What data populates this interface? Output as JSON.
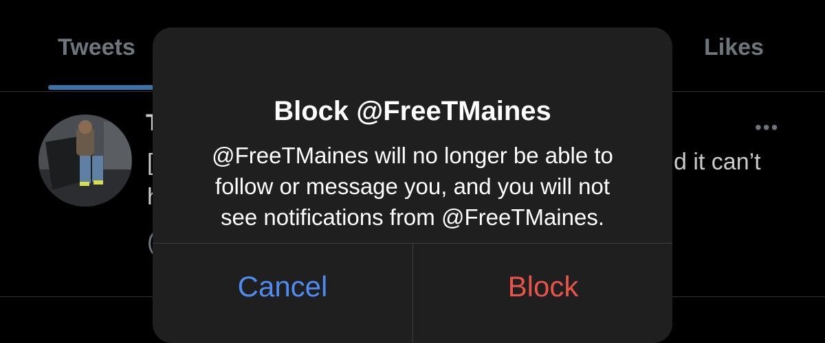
{
  "profile": {
    "tabs": [
      {
        "label": "Tweets",
        "active": true
      },
      {
        "label": "Likes",
        "active": false
      }
    ],
    "accent_color": "#3b72a3",
    "tweet": {
      "name_fragment": "T",
      "line1_left_fragment": "[",
      "line1_right_fragment": "d it can’t",
      "line2_left_fragment": "h",
      "line3_left_fragment": "(",
      "more_icon": "more-horizontal-icon"
    }
  },
  "alert": {
    "title": "Block @FreeTMaines",
    "message_lines": [
      "@FreeTMaines will no longer be able to",
      "follow or message you, and you will not",
      "see notifications from @FreeTMaines."
    ],
    "buttons": {
      "cancel_label": "Cancel",
      "block_label": "Block"
    },
    "colors": {
      "background": "#1f1f1f",
      "cancel": "#4f8cf0",
      "destructive": "#e9544a"
    }
  }
}
